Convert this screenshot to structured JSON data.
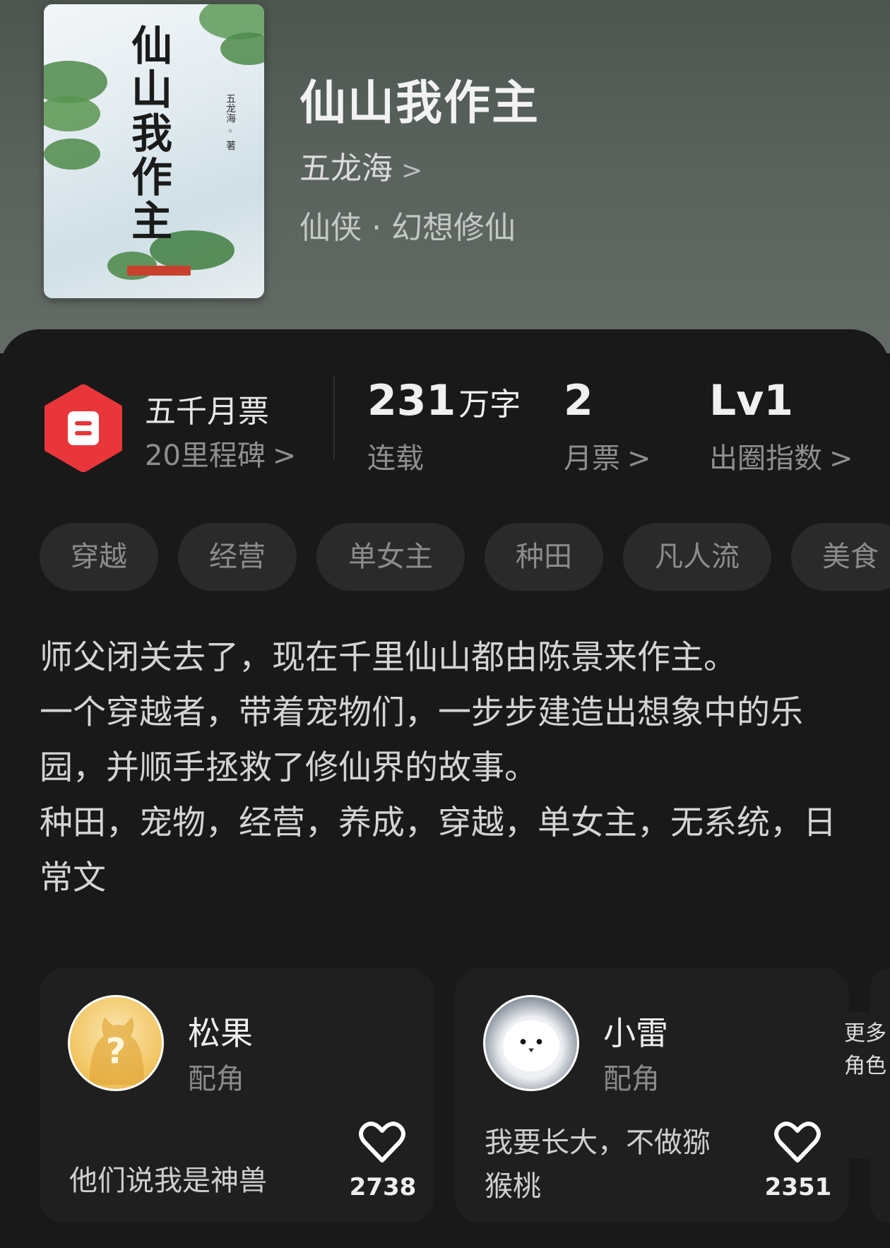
{
  "book": {
    "title": "仙山我作主",
    "author": "五龙海",
    "genre": "仙侠 · 幻想修仙",
    "cover_title": "仙山我作主",
    "cover_author": "五龙海 ◦ 著"
  },
  "badge": {
    "line1": "五千月票",
    "line2": "20里程碑"
  },
  "stats": [
    {
      "value": "231",
      "unit": "万字",
      "label": "连载"
    },
    {
      "value": "2",
      "unit": "",
      "label": "月票"
    },
    {
      "value": "Lv1",
      "unit": "",
      "label": "出圈指数"
    }
  ],
  "tags": [
    "穿越",
    "经营",
    "单女主",
    "种田",
    "凡人流",
    "美食"
  ],
  "description": [
    "师父闭关去了，现在千里仙山都由陈景来作主。",
    "一个穿越者，带着宠物们，一步步建造出想象中的乐园，并顺手拯救了修仙界的故事。",
    "种田，宠物，经营，养成，穿越，单女主，无系统，日常文"
  ],
  "characters": [
    {
      "name": "松果",
      "role": "配角",
      "quote": "他们说我是神兽",
      "likes": "2738"
    },
    {
      "name": "小雷",
      "role": "配角",
      "quote": "我要长大，不做猕猴桃",
      "likes": "2351"
    }
  ],
  "more_roles": "更多角色",
  "colors": {
    "badge_red": "#e8363a",
    "panel_bg": "#191919",
    "tag_bg": "#2a2a2a"
  }
}
